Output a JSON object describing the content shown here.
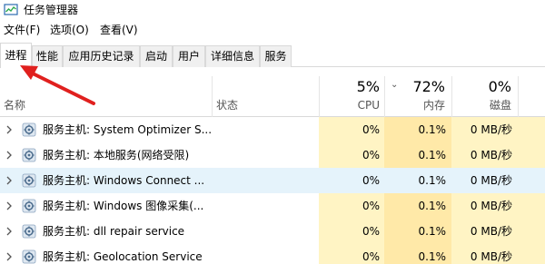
{
  "window": {
    "title": "任务管理器",
    "icon": "task-manager-icon"
  },
  "menu": [
    {
      "label": "文件(F)"
    },
    {
      "label": "选项(O)"
    },
    {
      "label": "查看(V)"
    }
  ],
  "tabs": [
    {
      "label": "进程",
      "active": true
    },
    {
      "label": "性能"
    },
    {
      "label": "应用历史记录"
    },
    {
      "label": "启动"
    },
    {
      "label": "用户"
    },
    {
      "label": "详细信息"
    },
    {
      "label": "服务"
    }
  ],
  "columns": {
    "name": {
      "label": "名称"
    },
    "status": {
      "label": "状态"
    },
    "cpu": {
      "label": "CPU",
      "percent": "5%"
    },
    "memory": {
      "label": "内存",
      "percent": "72%",
      "sorted": "descending"
    },
    "disk": {
      "label": "磁盘",
      "percent": "0%"
    }
  },
  "colors": {
    "heat_light": "#fff4c4",
    "heat_medium": "#ffe9a8",
    "selected_row": "#e5f3fb",
    "annotation_arrow": "#e0201e"
  },
  "rows": [
    {
      "name": "服务主机: System Optimizer S...",
      "cpu": "0%",
      "memory": "0.1%",
      "disk": "0 MB/秒",
      "icon": "service-gear-icon"
    },
    {
      "name": "服务主机: 本地服务(网络受限)",
      "cpu": "0%",
      "memory": "0.1%",
      "disk": "0 MB/秒",
      "icon": "service-gear-icon"
    },
    {
      "name": "服务主机: Windows Connect ...",
      "cpu": "0%",
      "memory": "0.1%",
      "disk": "0 MB/秒",
      "icon": "service-gear-icon",
      "selected": true
    },
    {
      "name": "服务主机: Windows 图像采集(...",
      "cpu": "0%",
      "memory": "0.1%",
      "disk": "0 MB/秒",
      "icon": "service-gear-icon"
    },
    {
      "name": "服务主机: dll repair service",
      "cpu": "0%",
      "memory": "0.1%",
      "disk": "0 MB/秒",
      "icon": "service-gear-icon"
    },
    {
      "name": "服务主机: Geolocation Service",
      "cpu": "0%",
      "memory": "0.1%",
      "disk": "0 MB/秒",
      "icon": "service-gear-icon"
    }
  ]
}
